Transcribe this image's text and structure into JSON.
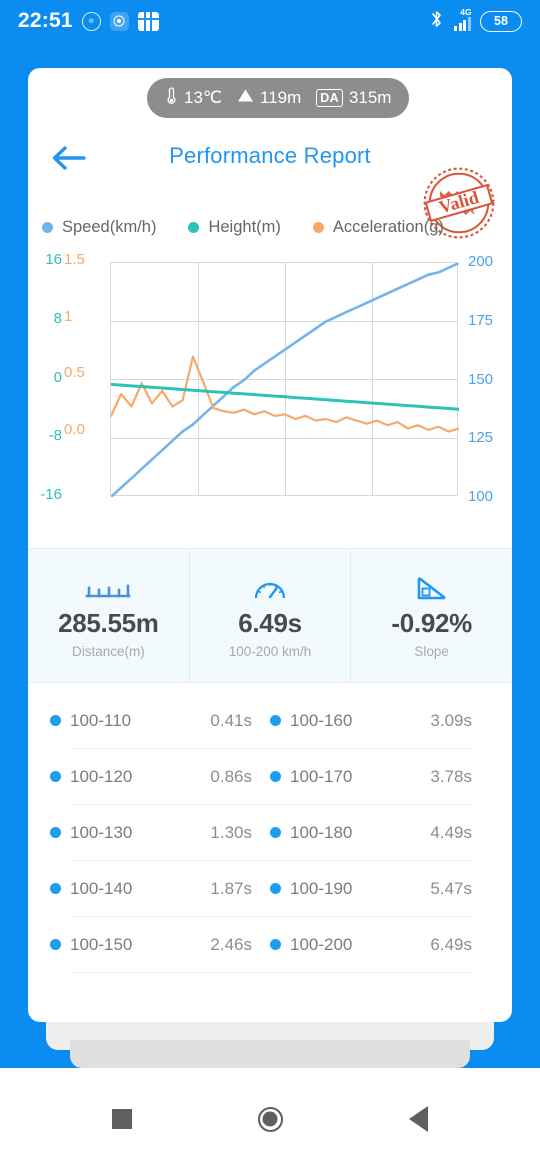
{
  "status_bar": {
    "time": "22:51",
    "icons_left": [
      "circle-badge-icon",
      "record-icon",
      "grid-icon"
    ],
    "bluetooth_icon": "bluetooth-icon",
    "network_label": "4G",
    "battery_level": "58"
  },
  "info_pill": {
    "temperature": "13℃",
    "temperature_icon": "thermometer-icon",
    "altitude": "119m",
    "altitude_icon": "mountain-icon",
    "da_badge": "DA",
    "da_value": "315m"
  },
  "header": {
    "back_icon": "arrow-left-icon",
    "title": "Performance Report",
    "stamp_text": "Valid"
  },
  "legend": [
    {
      "label": "Speed(km/h)",
      "color": "#74b4ec"
    },
    {
      "label": "Height(m)",
      "color": "#2bc2b8"
    },
    {
      "label": "Acceleration(g)",
      "color": "#f6a96c"
    }
  ],
  "chart_data": {
    "type": "line",
    "title": "",
    "xlabel": "",
    "grid": true,
    "legend_position": "top",
    "axes": {
      "height_axis": {
        "label": "Height(m)",
        "color": "#2bc2b8",
        "side": "left",
        "ticks": [
          "16",
          "8",
          "0",
          "-8",
          "-16"
        ],
        "range": [
          -16,
          16
        ]
      },
      "acceleration_axis": {
        "label": "Acceleration(g)",
        "color": "#f5a96a",
        "side": "left",
        "ticks": [
          "1.5",
          "1",
          "0.5",
          "0.0"
        ],
        "range": [
          0.0,
          1.5
        ]
      },
      "speed_axis": {
        "label": "Speed(km/h)",
        "color": "#4ea2e8",
        "side": "right",
        "ticks": [
          "200",
          "175",
          "150",
          "125",
          "100"
        ],
        "range": [
          100,
          200
        ]
      }
    },
    "series": [
      {
        "name": "Speed(km/h)",
        "color": "#74b4ec",
        "axis": "speed_axis",
        "values": [
          100,
          104,
          108,
          112,
          116,
          120,
          124,
          128,
          131,
          135,
          139,
          143,
          147,
          150,
          154,
          157,
          160,
          163,
          166,
          169,
          172,
          175,
          177,
          179,
          181,
          183,
          185,
          187,
          189,
          191,
          193,
          195,
          196,
          198,
          200
        ]
      },
      {
        "name": "Height(m)",
        "color": "#2bc2b8",
        "axis": "height_axis",
        "values": [
          -0.6,
          -0.7,
          -0.8,
          -0.9,
          -1.0,
          -1.1,
          -1.2,
          -1.3,
          -1.4,
          -1.5,
          -1.6,
          -1.7,
          -1.8,
          -1.9,
          -2.0,
          -2.1,
          -2.2,
          -2.3,
          -2.4,
          -2.5,
          -2.6,
          -2.7,
          -2.8,
          -2.9,
          -3.0,
          -3.1,
          -3.2,
          -3.3,
          -3.4,
          -3.5,
          -3.6,
          -3.7,
          -3.8,
          -3.9,
          -4.0
        ]
      },
      {
        "name": "Acceleration(g)",
        "color": "#f6a96c",
        "axis": "acceleration_axis",
        "values": [
          0.52,
          0.66,
          0.58,
          0.73,
          0.6,
          0.68,
          0.58,
          0.62,
          0.9,
          0.74,
          0.57,
          0.55,
          0.54,
          0.56,
          0.53,
          0.55,
          0.52,
          0.53,
          0.5,
          0.52,
          0.49,
          0.5,
          0.48,
          0.51,
          0.49,
          0.47,
          0.49,
          0.46,
          0.48,
          0.44,
          0.46,
          0.43,
          0.45,
          0.42,
          0.44
        ]
      }
    ]
  },
  "stats": [
    {
      "icon": "ruler-icon",
      "value": "285.55m",
      "label": "Distance(m)"
    },
    {
      "icon": "speedometer-icon",
      "value": "6.49s",
      "label": "100-200 km/h"
    },
    {
      "icon": "slope-icon",
      "value": "-0.92%",
      "label": "Slope"
    }
  ],
  "split_table": {
    "rows": [
      {
        "left_label": "100-110",
        "left_value": "0.41s",
        "right_label": "100-160",
        "right_value": "3.09s"
      },
      {
        "left_label": "100-120",
        "left_value": "0.86s",
        "right_label": "100-170",
        "right_value": "3.78s"
      },
      {
        "left_label": "100-130",
        "left_value": "1.30s",
        "right_label": "100-180",
        "right_value": "4.49s"
      },
      {
        "left_label": "100-140",
        "left_value": "1.87s",
        "right_label": "100-190",
        "right_value": "5.47s"
      },
      {
        "left_label": "100-150",
        "left_value": "2.46s",
        "right_label": "100-200",
        "right_value": "6.49s"
      }
    ]
  },
  "nav_bar": {
    "recents": "recents-square-icon",
    "home": "home-circle-icon",
    "back": "back-triangle-icon"
  },
  "colors": {
    "brand_blue": "#0a8cf0",
    "title_blue": "#2196f3",
    "speed": "#74b4ec",
    "height": "#2bc2b8",
    "acceleration": "#f6a96c",
    "stamp_red": "#d9543c"
  }
}
